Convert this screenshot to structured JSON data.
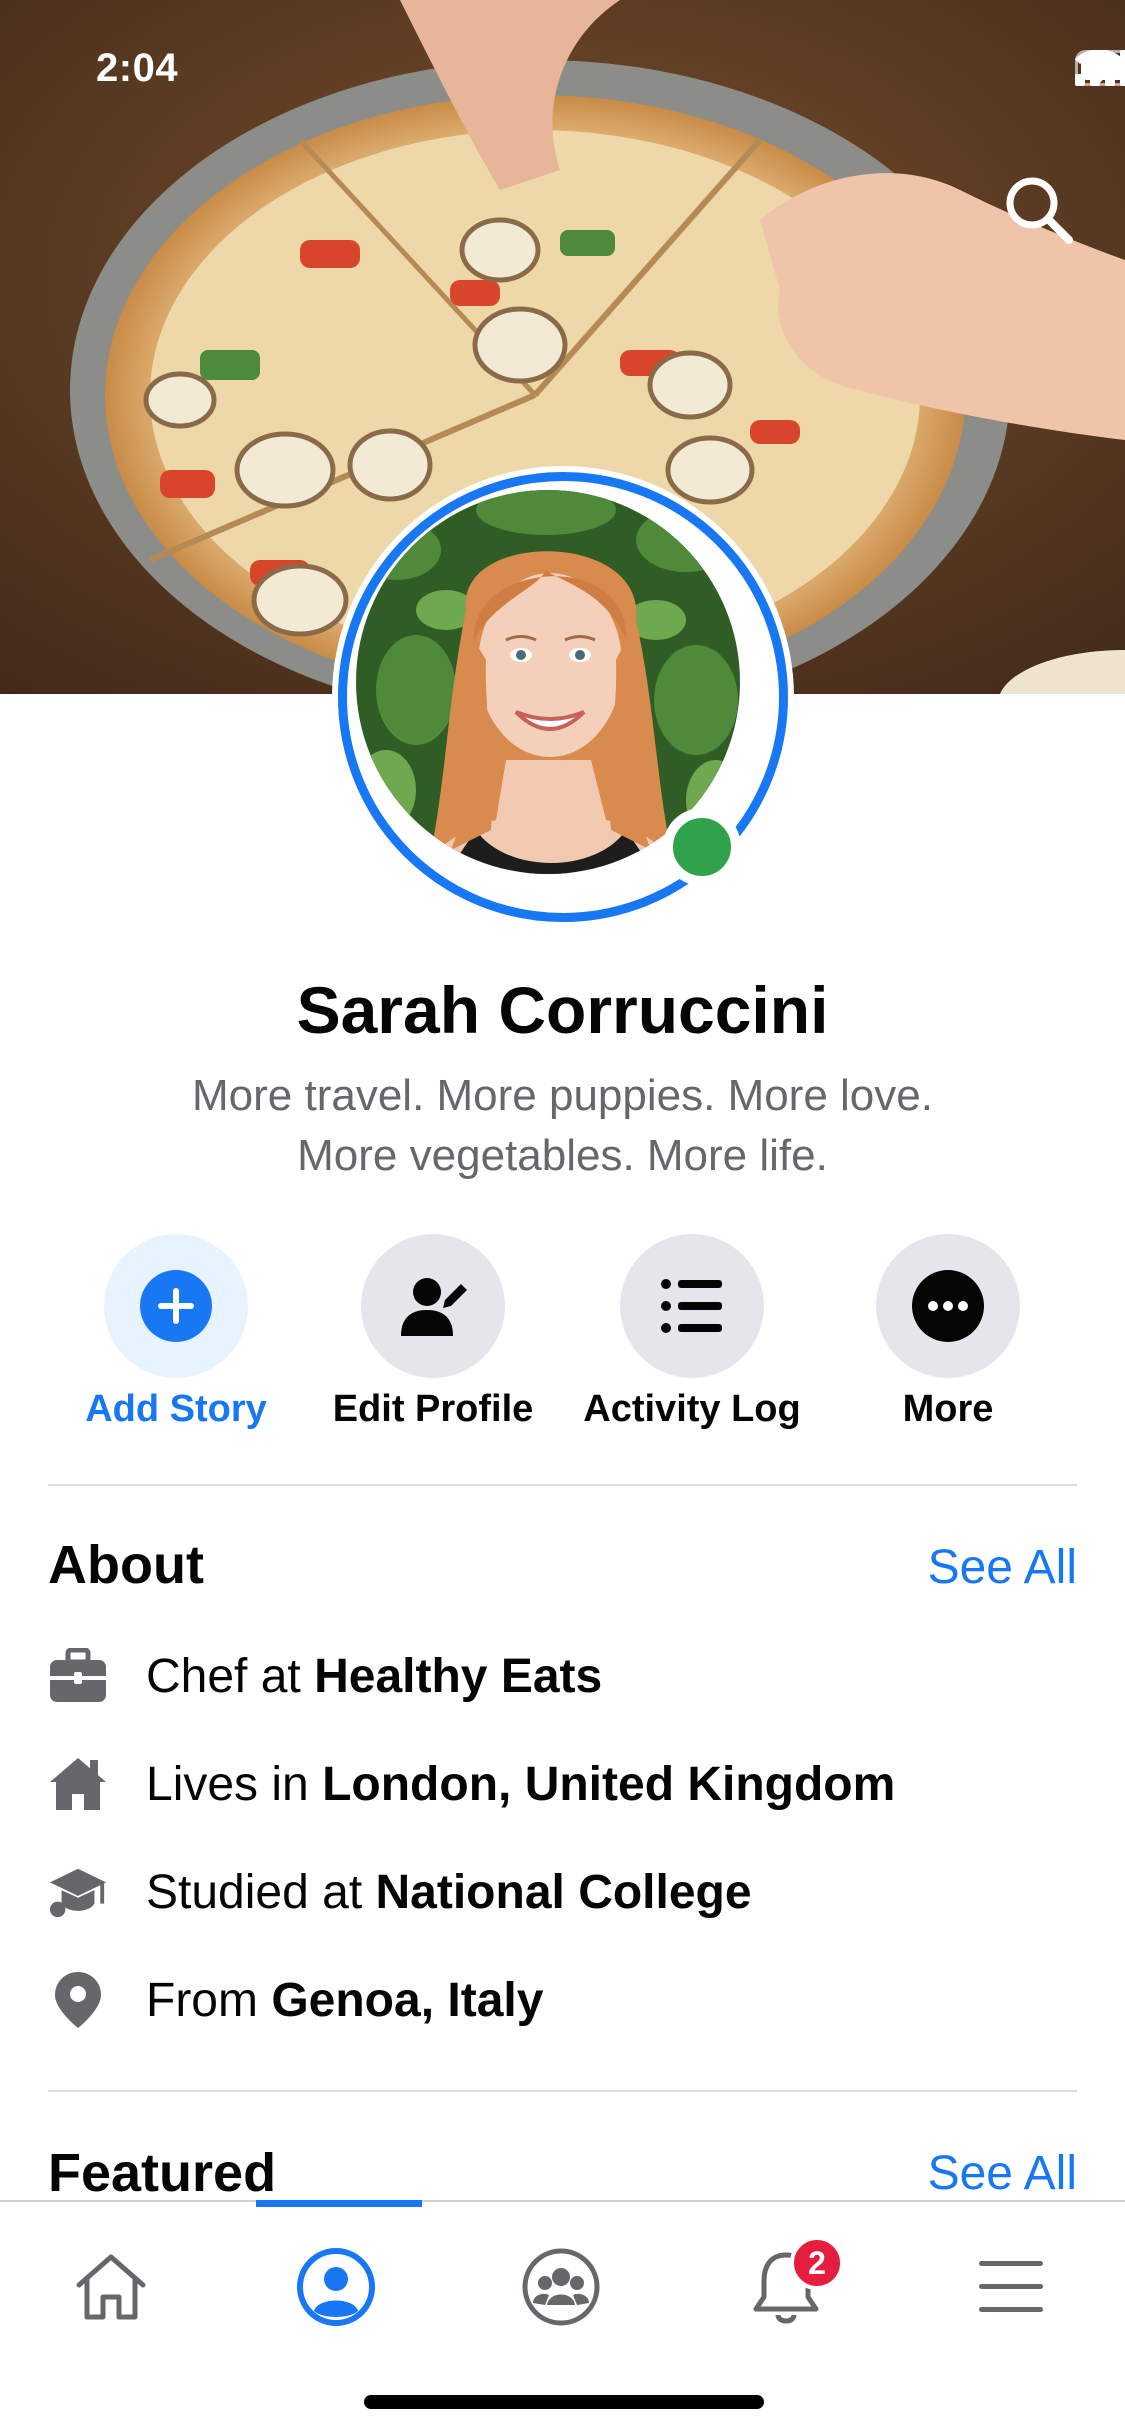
{
  "status_bar": {
    "time": "2:04"
  },
  "profile": {
    "name": "Sarah Corruccini",
    "bio_line1": "More travel. More puppies. More love.",
    "bio_line2": "More vegetables. More life."
  },
  "actions": [
    {
      "label": "Add Story",
      "icon": "plus-circle-icon"
    },
    {
      "label": "Edit Profile",
      "icon": "person-edit-icon"
    },
    {
      "label": "Activity Log",
      "icon": "list-icon"
    },
    {
      "label": "More",
      "icon": "more-dots-icon"
    }
  ],
  "about": {
    "title": "About",
    "see_all": "See All",
    "items": [
      {
        "icon": "briefcase-icon",
        "prefix": "Chef at ",
        "value": "Healthy Eats"
      },
      {
        "icon": "house-icon",
        "prefix": "Lives in ",
        "value": "London, United Kingdom"
      },
      {
        "icon": "graduation-cap-icon",
        "prefix": "Studied at ",
        "value": "National College"
      },
      {
        "icon": "location-pin-icon",
        "prefix": "From ",
        "value": "Genoa, Italy"
      }
    ]
  },
  "featured": {
    "title": "Featured",
    "see_all": "See All"
  },
  "tabbar": {
    "items": [
      "home-icon",
      "profile-icon",
      "groups-icon",
      "notifications-icon",
      "menu-icon"
    ],
    "active": "profile-icon",
    "notification_count": "2"
  },
  "colors": {
    "accent": "#1877f2",
    "online": "#31a24c",
    "badge": "#e41e3f",
    "secondary_text": "#65676b"
  }
}
